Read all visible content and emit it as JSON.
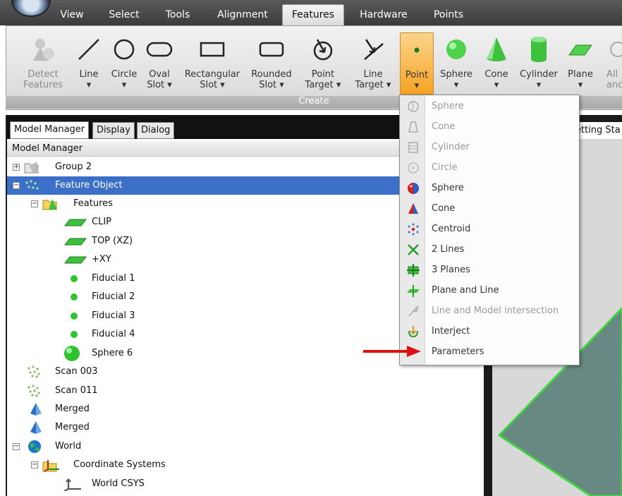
{
  "menu": {
    "tabs": [
      "View",
      "Select",
      "Tools",
      "Alignment",
      "Features",
      "Hardware",
      "Points"
    ],
    "active_tab": "Features"
  },
  "ribbon": {
    "group_label": "Create",
    "buttons": [
      {
        "line1": "Detect",
        "line2": "Features",
        "icon": "detect-features-icon"
      },
      {
        "line1": "Line",
        "line2": "▾",
        "icon": "line-icon"
      },
      {
        "line1": "Circle",
        "line2": "▾",
        "icon": "circle-icon"
      },
      {
        "line1": "Oval",
        "line2": "Slot ▾",
        "icon": "oval-slot-icon"
      },
      {
        "line1": "Rectangular",
        "line2": "Slot ▾",
        "icon": "rectangular-slot-icon"
      },
      {
        "line1": "Rounded",
        "line2": "Slot ▾",
        "icon": "rounded-slot-icon"
      },
      {
        "line1": "Point",
        "line2": "Target ▾",
        "icon": "point-target-icon"
      },
      {
        "line1": "Line",
        "line2": "Target ▾",
        "icon": "line-target-icon"
      },
      {
        "line1": "Point",
        "line2": "▾",
        "icon": "point-icon"
      },
      {
        "line1": "Sphere",
        "line2": "▾",
        "icon": "sphere-icon"
      },
      {
        "line1": "Cone",
        "line2": "▾",
        "icon": "cone-icon"
      },
      {
        "line1": "Cylinder",
        "line2": "▾",
        "icon": "cylinder-icon"
      },
      {
        "line1": "Plane",
        "line2": "▾",
        "icon": "plane-icon"
      },
      {
        "line1": "All",
        "line2": "anc",
        "icon": "all-icon"
      }
    ]
  },
  "panel": {
    "tabs": [
      "Model Manager",
      "Display",
      "Dialog"
    ],
    "header": "Model Manager",
    "tree": [
      {
        "label": "Group 2",
        "icon": "folder-icon"
      },
      {
        "label": "Feature Object",
        "icon": "feature-object-icon"
      },
      {
        "label": "Features",
        "icon": "features-folder-icon"
      },
      {
        "label": "CLIP",
        "icon": "plane-icon"
      },
      {
        "label": "TOP (XZ)",
        "icon": "plane-icon"
      },
      {
        "label": "+XY",
        "icon": "plane-icon"
      },
      {
        "label": "Fiducial 1",
        "icon": "point-icon"
      },
      {
        "label": "Fiducial 2",
        "icon": "point-icon"
      },
      {
        "label": "Fiducial 3",
        "icon": "point-icon"
      },
      {
        "label": "Fiducial 4",
        "icon": "point-icon"
      },
      {
        "label": "Sphere 6",
        "icon": "sphere-icon"
      },
      {
        "label": "Scan 003",
        "icon": "scan-icon"
      },
      {
        "label": "Scan 011",
        "icon": "scan-icon"
      },
      {
        "label": "Merged",
        "icon": "mesh-icon"
      },
      {
        "label": "Merged",
        "icon": "mesh-icon"
      },
      {
        "label": "World",
        "icon": "globe-icon"
      },
      {
        "label": "Coordinate Systems",
        "icon": "coordinate-systems-icon"
      },
      {
        "label": "World CSYS",
        "icon": "csys-icon"
      }
    ]
  },
  "viewport": {
    "tab_label": "etting Sta"
  },
  "dropdown": {
    "items": [
      {
        "label": "Sphere",
        "icon": "sphere-icon",
        "enabled": false
      },
      {
        "label": "Cone",
        "icon": "cone-icon",
        "enabled": false
      },
      {
        "label": "Cylinder",
        "icon": "cylinder-icon",
        "enabled": false
      },
      {
        "label": "Circle",
        "icon": "circle-icon",
        "enabled": false
      },
      {
        "label": "Sphere",
        "icon": "sphere-icon",
        "enabled": true
      },
      {
        "label": "Cone",
        "icon": "cone-icon",
        "enabled": true
      },
      {
        "label": "Centroid",
        "icon": "centroid-icon",
        "enabled": true
      },
      {
        "label": "2 Lines",
        "icon": "two-lines-icon",
        "enabled": true
      },
      {
        "label": "3 Planes",
        "icon": "three-planes-icon",
        "enabled": true
      },
      {
        "label": "Plane and Line",
        "icon": "plane-and-line-icon",
        "enabled": true
      },
      {
        "label": "Line and Model intersection",
        "icon": "line-model-intersection-icon",
        "enabled": false
      },
      {
        "label": "Interject",
        "icon": "interject-icon",
        "enabled": true
      },
      {
        "label": "Parameters",
        "icon": "",
        "enabled": true
      }
    ]
  },
  "colors": {
    "selection": "#3c6fc7",
    "point_feature": "#2fc42f",
    "active_button": "#f6a324",
    "annotation_arrow": "#e01010"
  }
}
